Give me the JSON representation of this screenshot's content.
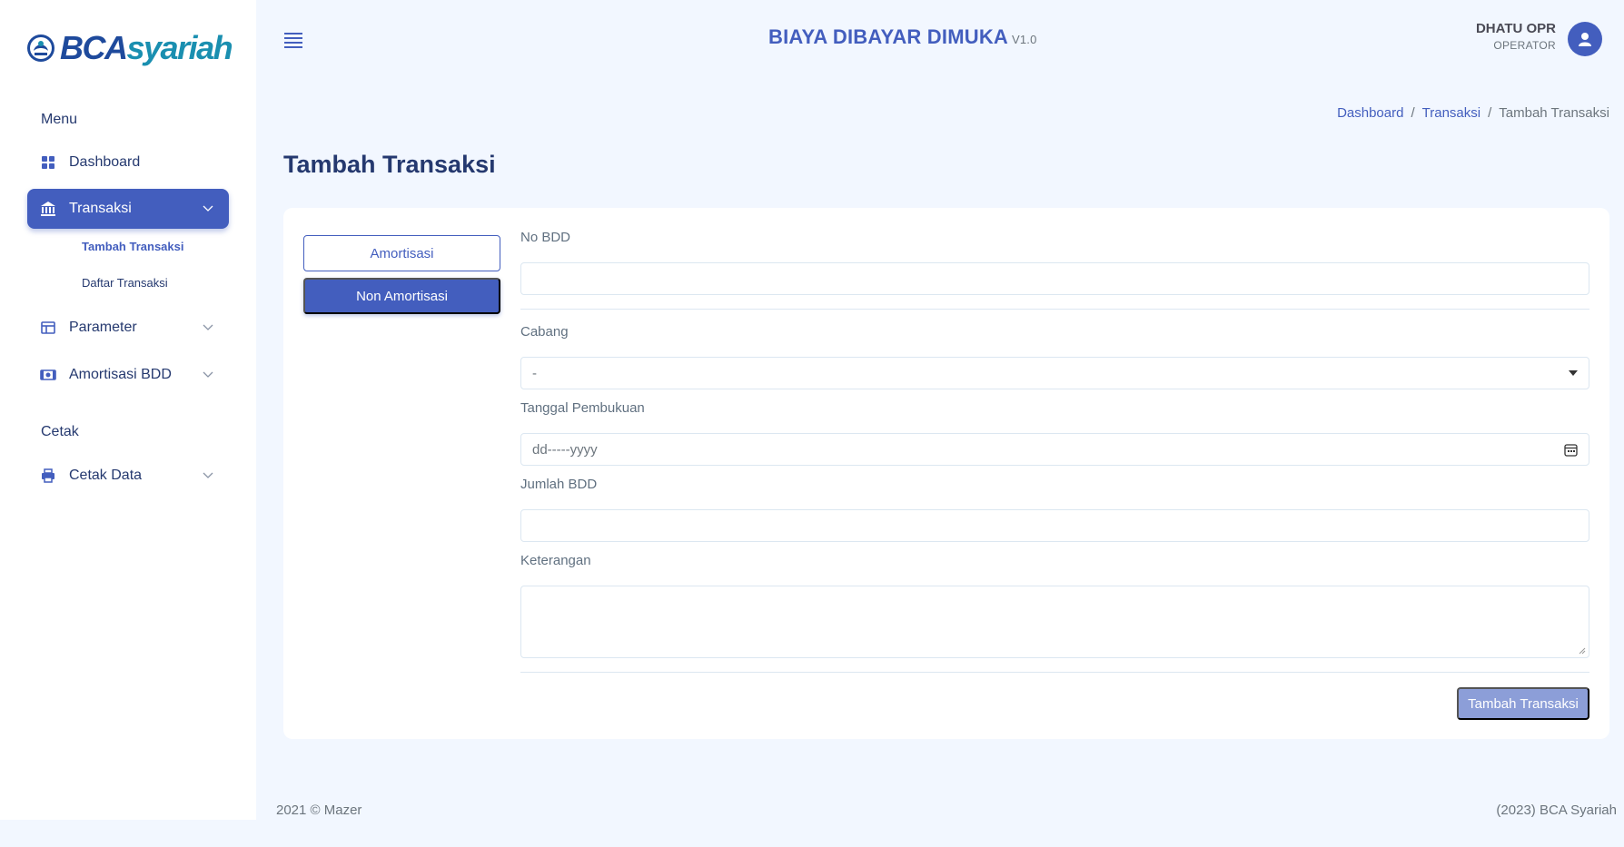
{
  "brand": {
    "part1": "BCA",
    "part2": "syariah"
  },
  "header": {
    "title": "BIAYA DIBAYAR DIMUKA",
    "version": "V1.0"
  },
  "user": {
    "name": "DHATU OPR",
    "role": "OPERATOR"
  },
  "sidebar": {
    "section_menu": "Menu",
    "section_print": "Cetak",
    "items": [
      {
        "label": "Dashboard",
        "icon": "grid-icon"
      },
      {
        "label": "Transaksi",
        "icon": "bank-icon",
        "active": true
      },
      {
        "label": "Parameter",
        "icon": "table-icon"
      },
      {
        "label": "Amortisasi BDD",
        "icon": "cash-icon"
      },
      {
        "label": "Cetak Data",
        "icon": "printer-icon"
      }
    ],
    "subitems": [
      {
        "label": "Tambah Transaksi",
        "current": true
      },
      {
        "label": "Daftar Transaksi"
      }
    ]
  },
  "breadcrumb": [
    "Dashboard",
    "Transaksi",
    "Tambah Transaksi"
  ],
  "breadcrumb_sep": "/",
  "page_title": "Tambah Transaksi",
  "tabs": [
    "Amortisasi",
    "Non Amortisasi"
  ],
  "form": {
    "no_bdd_label": "No BDD",
    "no_bdd_value": "",
    "cabang_label": "Cabang",
    "cabang_value": "-",
    "tanggal_label": "Tanggal Pembukuan",
    "tanggal_placeholder": "dd-----yyyy",
    "jumlah_label": "Jumlah BDD",
    "jumlah_value": "",
    "keterangan_label": "Keterangan",
    "keterangan_value": "",
    "submit_label": "Tambah Transaksi"
  },
  "footer": {
    "left": "2021 © Mazer",
    "right": "(2023) BCA Syariah"
  },
  "colors": {
    "primary": "#435ebe",
    "background": "#f2f7ff",
    "text": "#25396f"
  }
}
